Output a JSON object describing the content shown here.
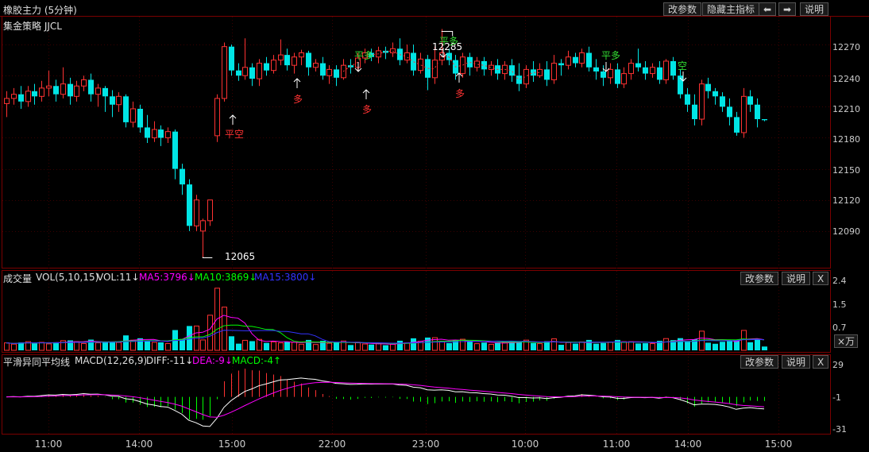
{
  "header": {
    "title": "橡胶主力 (5分钟)",
    "strategy": "集金策略 JJCL",
    "buttons": {
      "params": "改参数",
      "hide_indicator": "隐藏主指标",
      "left_arrow": "⬅",
      "right_arrow": "➡",
      "help": "说明"
    }
  },
  "price_axis": [
    "12270",
    "12240",
    "12210",
    "12180",
    "12150",
    "12120",
    "12090"
  ],
  "price_high_label": "12285",
  "price_low_label": "12065",
  "signals": {
    "flat_empty": "平空",
    "flat_long": "平多",
    "long": "多",
    "short": "空"
  },
  "volume_panel": {
    "name": "成交量",
    "params": "VOL(5,10,15)",
    "vol": "VOL:11↓",
    "ma5": "MA5:3796↓",
    "ma10": "MA10:3869↓",
    "ma15": "MA15:3800↓",
    "axis": [
      "2.4",
      "1.5",
      "0.7"
    ],
    "unit_button": "×万",
    "buttons": {
      "params": "改参数",
      "help": "说明",
      "close": "X"
    }
  },
  "macd_panel": {
    "name": "平滑异同平均线",
    "params": "MACD(12,26,9)",
    "diff": "DIFF:-11↓",
    "dea": "DEA:-9↓",
    "macd": "MACD:-4↑",
    "axis": [
      "29",
      "-1",
      "-31"
    ],
    "buttons": {
      "params": "改参数",
      "help": "说明",
      "close": "X"
    }
  },
  "time_axis": [
    "11:00",
    "14:00",
    "15:00",
    "22:00",
    "23:00",
    "10:00",
    "11:00",
    "14:00",
    "15:00"
  ],
  "colors": {
    "up": "#ff3232",
    "down": "#00e5e5",
    "ma5": "#ff00ff",
    "ma10": "#00ff00",
    "ma15": "#3333ff",
    "signal_green": "#33dd33",
    "signal_red": "#ff3232"
  },
  "chart_data": {
    "type": "candlestick",
    "title": "橡胶主力 (5分钟)",
    "ylim": [
      12060,
      12290
    ],
    "price_high": 12285,
    "price_low": 12065,
    "candles": [
      [
        12213,
        12218,
        12200,
        12225
      ],
      [
        12218,
        12222,
        12212,
        12228
      ],
      [
        12222,
        12215,
        12208,
        12230
      ],
      [
        12215,
        12225,
        12210,
        12230
      ],
      [
        12225,
        12220,
        12212,
        12232
      ],
      [
        12220,
        12228,
        12215,
        12235
      ],
      [
        12228,
        12230,
        12220,
        12245
      ],
      [
        12230,
        12222,
        12215,
        12236
      ],
      [
        12222,
        12232,
        12218,
        12248
      ],
      [
        12232,
        12220,
        12212,
        12238
      ],
      [
        12220,
        12230,
        12215,
        12235
      ],
      [
        12230,
        12236,
        12225,
        12240
      ],
      [
        12236,
        12222,
        12215,
        12242
      ],
      [
        12222,
        12228,
        12210,
        12232
      ],
      [
        12228,
        12220,
        12205,
        12230
      ],
      [
        12220,
        12212,
        12200,
        12226
      ],
      [
        12212,
        12220,
        12205,
        12224
      ],
      [
        12220,
        12195,
        12190,
        12222
      ],
      [
        12195,
        12208,
        12190,
        12215
      ],
      [
        12208,
        12190,
        12185,
        12212
      ],
      [
        12190,
        12180,
        12175,
        12202
      ],
      [
        12180,
        12188,
        12176,
        12196
      ],
      [
        12188,
        12180,
        12172,
        12192
      ],
      [
        12180,
        12186,
        12175,
        12190
      ],
      [
        12186,
        12150,
        12140,
        12188
      ],
      [
        12150,
        12135,
        12125,
        12155
      ],
      [
        12135,
        12095,
        12090,
        12140
      ],
      [
        12095,
        12120,
        12090,
        12125
      ],
      [
        12090,
        12100,
        12065,
        12102
      ],
      [
        12100,
        12120,
        12095,
        12120
      ],
      [
        12182,
        12218,
        12176,
        12222
      ],
      [
        12218,
        12268,
        12215,
        12272
      ],
      [
        12268,
        12245,
        12240,
        12270
      ],
      [
        12245,
        12240,
        12235,
        12252
      ],
      [
        12240,
        12248,
        12236,
        12276
      ],
      [
        12248,
        12237,
        12230,
        12252
      ],
      [
        12237,
        12252,
        12230,
        12256
      ],
      [
        12252,
        12245,
        12240,
        12258
      ],
      [
        12245,
        12255,
        12242,
        12260
      ],
      [
        12255,
        12260,
        12250,
        12275
      ],
      [
        12260,
        12250,
        12245,
        12266
      ],
      [
        12250,
        12258,
        12242,
        12262
      ],
      [
        12258,
        12262,
        12250,
        12265
      ],
      [
        12262,
        12248,
        12240,
        12264
      ],
      [
        12248,
        12252,
        12244,
        12256
      ],
      [
        12252,
        12240,
        12236,
        12258
      ],
      [
        12240,
        12246,
        12232,
        12250
      ],
      [
        12246,
        12238,
        12230,
        12250
      ],
      [
        12238,
        12250,
        12236,
        12256
      ],
      [
        12250,
        12248,
        12242,
        12256
      ],
      [
        12248,
        12257,
        12244,
        12262
      ],
      [
        12257,
        12262,
        12252,
        12266
      ],
      [
        12262,
        12258,
        12254,
        12266
      ],
      [
        12258,
        12264,
        12252,
        12268
      ],
      [
        12264,
        12262,
        12256,
        12268
      ],
      [
        12262,
        12266,
        12258,
        12272
      ],
      [
        12266,
        12255,
        12250,
        12276
      ],
      [
        12255,
        12262,
        12252,
        12270
      ],
      [
        12262,
        12245,
        12240,
        12270
      ],
      [
        12245,
        12256,
        12242,
        12262
      ],
      [
        12256,
        12238,
        12226,
        12260
      ],
      [
        12238,
        12255,
        12232,
        12268
      ],
      [
        12255,
        12262,
        12250,
        12285
      ],
      [
        12262,
        12255,
        12250,
        12266
      ],
      [
        12255,
        12242,
        12236,
        12260
      ],
      [
        12242,
        12258,
        12238,
        12262
      ],
      [
        12258,
        12248,
        12240,
        12262
      ],
      [
        12248,
        12254,
        12244,
        12258
      ],
      [
        12254,
        12246,
        12240,
        12258
      ],
      [
        12246,
        12250,
        12240,
        12254
      ],
      [
        12250,
        12242,
        12236,
        12256
      ],
      [
        12242,
        12250,
        12236,
        12254
      ],
      [
        12250,
        12240,
        12234,
        12256
      ],
      [
        12240,
        12232,
        12225,
        12252
      ],
      [
        12232,
        12246,
        12228,
        12250
      ],
      [
        12246,
        12240,
        12234,
        12254
      ],
      [
        12240,
        12246,
        12238,
        12252
      ],
      [
        12246,
        12236,
        12230,
        12254
      ],
      [
        12236,
        12252,
        12232,
        12260
      ],
      [
        12252,
        12250,
        12240,
        12256
      ],
      [
        12250,
        12258,
        12246,
        12264
      ],
      [
        12258,
        12252,
        12248,
        12262
      ],
      [
        12252,
        12262,
        12248,
        12266
      ],
      [
        12262,
        12248,
        12244,
        12268
      ],
      [
        12248,
        12244,
        12236,
        12256
      ],
      [
        12244,
        12238,
        12230,
        12250
      ],
      [
        12238,
        12246,
        12232,
        12252
      ],
      [
        12246,
        12232,
        12228,
        12252
      ],
      [
        12232,
        12242,
        12228,
        12248
      ],
      [
        12242,
        12252,
        12236,
        12256
      ],
      [
        12252,
        12248,
        12244,
        12266
      ],
      [
        12248,
        12242,
        12236,
        12254
      ],
      [
        12242,
        12248,
        12238,
        12252
      ],
      [
        12248,
        12236,
        12232,
        12254
      ],
      [
        12236,
        12254,
        12232,
        12256
      ],
      [
        12254,
        12240,
        12236,
        12258
      ],
      [
        12240,
        12222,
        12218,
        12246
      ],
      [
        12222,
        12212,
        12205,
        12228
      ],
      [
        12212,
        12198,
        12192,
        12222
      ],
      [
        12198,
        12232,
        12192,
        12236
      ],
      [
        12232,
        12225,
        12218,
        12238
      ],
      [
        12225,
        12220,
        12212,
        12228
      ],
      [
        12220,
        12210,
        12205,
        12224
      ],
      [
        12210,
        12200,
        12192,
        12218
      ],
      [
        12200,
        12185,
        12182,
        12205
      ],
      [
        12185,
        12220,
        12180,
        12228
      ],
      [
        12220,
        12212,
        12205,
        12226
      ],
      [
        12212,
        12198,
        12190,
        12218
      ],
      [
        12198,
        12197,
        12196,
        12198
      ]
    ],
    "macd_ylim": [
      -31,
      29
    ]
  }
}
